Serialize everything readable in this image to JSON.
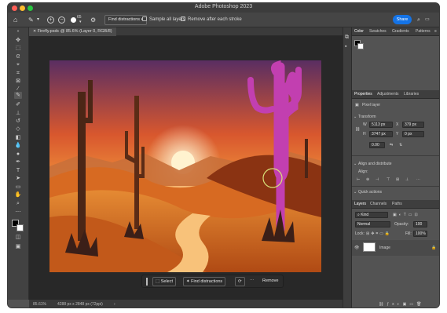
{
  "window": {
    "title": "Adobe Photoshop 2023",
    "traffic_colors": [
      "#ff5f57",
      "#febc2e",
      "#28c840"
    ]
  },
  "options_bar": {
    "find_distractions": "Find distractions",
    "sample_all_layers": "Sample all layers",
    "remove_after_stroke": "Remove after each stroke",
    "brush_size": "65",
    "share": "Share"
  },
  "document_tab": {
    "label": "Firefly.psdc @ 85.6% (Layer 0, RGB/8)"
  },
  "contextual_bar": {
    "select": "Select",
    "find_distractions": "Find distractions",
    "remove": "Remove"
  },
  "status": {
    "zoom": "85.61%",
    "doc_info": "4288 px x 2848 px (72ppi)"
  },
  "panels": {
    "top_tabs": [
      "Color",
      "Swatches",
      "Gradients",
      "Patterns"
    ],
    "props_tabs": [
      "Properties",
      "Adjustments",
      "Libraries"
    ],
    "pixel_layer": "Pixel layer",
    "transform_header": "Transform",
    "w_label": "W",
    "w_value": "5113 px",
    "x_label": "X",
    "x_value": "379 px",
    "h_label": "H",
    "h_value": "3747 px",
    "y_label": "Y",
    "y_value": "0 px",
    "angle_value": "0.00",
    "align_header": "Align and distribute",
    "align_label": "Align:",
    "quick_actions": "Quick actions",
    "layers_tabs": [
      "Layers",
      "Channels",
      "Paths"
    ],
    "kind": "Kind",
    "blend_mode": "Normal",
    "opacity_label": "Opacity:",
    "opacity_value": "100",
    "lock_label": "Lock:",
    "fill_label": "Fill:",
    "fill_value": "100%",
    "layer_name": "Image"
  },
  "colors": {
    "accent": "#1473e6",
    "brush_stroke": "#c23fb0"
  }
}
